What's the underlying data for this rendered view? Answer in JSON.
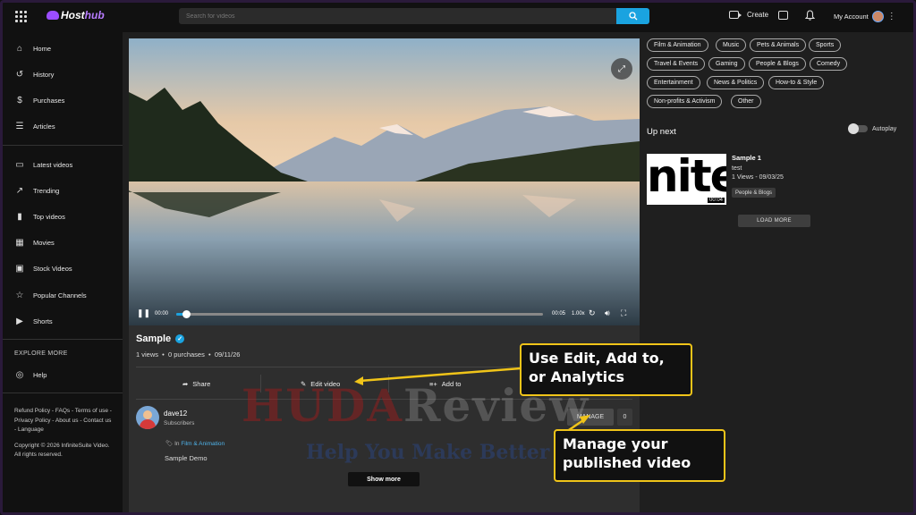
{
  "brand": {
    "logo_a": "Host",
    "logo_b": "hub"
  },
  "search": {
    "placeholder": "Search for videos"
  },
  "header": {
    "create_label": "Create",
    "account_label": "My Account"
  },
  "sidebar": {
    "items": [
      {
        "label": "Home",
        "icon": "home-icon"
      },
      {
        "label": "History",
        "icon": "history-icon"
      },
      {
        "label": "Purchases",
        "icon": "dollar-icon"
      },
      {
        "label": "Articles",
        "icon": "article-icon"
      },
      {
        "label": "Latest videos",
        "icon": "video-icon"
      },
      {
        "label": "Trending",
        "icon": "trending-icon"
      },
      {
        "label": "Top videos",
        "icon": "bar-chart-icon"
      },
      {
        "label": "Movies",
        "icon": "film-icon"
      },
      {
        "label": "Stock Videos",
        "icon": "stock-video-icon"
      },
      {
        "label": "Popular Channels",
        "icon": "star-icon"
      },
      {
        "label": "Shorts",
        "icon": "shorts-icon"
      }
    ],
    "explore_heading": "EXPLORE MORE",
    "help_label": "Help",
    "footer_links": "Refund Policy - FAQs - Terms of use - Privacy Policy - About us - Contact us - Language",
    "copyright": "Copyright © 2026 InfiniteSuite Video. All rights reserved."
  },
  "player": {
    "current_time": "00:00",
    "duration": "00:05",
    "speed": "1.00x",
    "progress": 0.02
  },
  "video": {
    "title": "Sample",
    "views": "1 views",
    "purchases": "0 purchases",
    "date": "09/11/26",
    "actions": {
      "share": "Share",
      "edit": "Edit video",
      "add_to": "Add to"
    },
    "channel_name": "dave12",
    "channel_subs": "Subscribers",
    "manage_label": "MANAGE",
    "manage_count": "0",
    "category_prefix": "In",
    "category": "Film & Animation",
    "description": "Sample Demo",
    "show_more": "Show more"
  },
  "categories": [
    "Film & Animation",
    "Music",
    "Pets & Animals",
    "Sports",
    "Travel & Events",
    "Gaming",
    "People & Blogs",
    "Comedy",
    "Entertainment",
    "News & Politics",
    "How-to & Style",
    "Non-profits & Activism",
    "Other"
  ],
  "upnext": {
    "heading": "Up next",
    "autoplay_label": "Autoplay",
    "autoplay_on": false,
    "item": {
      "thumb_text": "nite",
      "duration": "00:04",
      "title": "Sample 1",
      "subtitle": "test",
      "meta": "1 Views - 09/03/25",
      "tag": "People & Blogs"
    },
    "load_more": "LOAD MORE"
  },
  "watermark": {
    "line1a": "HUDA",
    "line1b": "Review",
    "line2": "Help You Make Better Decisions"
  },
  "callouts": {
    "edit": "Use Edit, Add to, or Analytics",
    "manage": "Manage your published video"
  },
  "colors": {
    "accent": "#1aa3e0",
    "callout_border": "#f0c419",
    "brand": "#9b4dff"
  }
}
